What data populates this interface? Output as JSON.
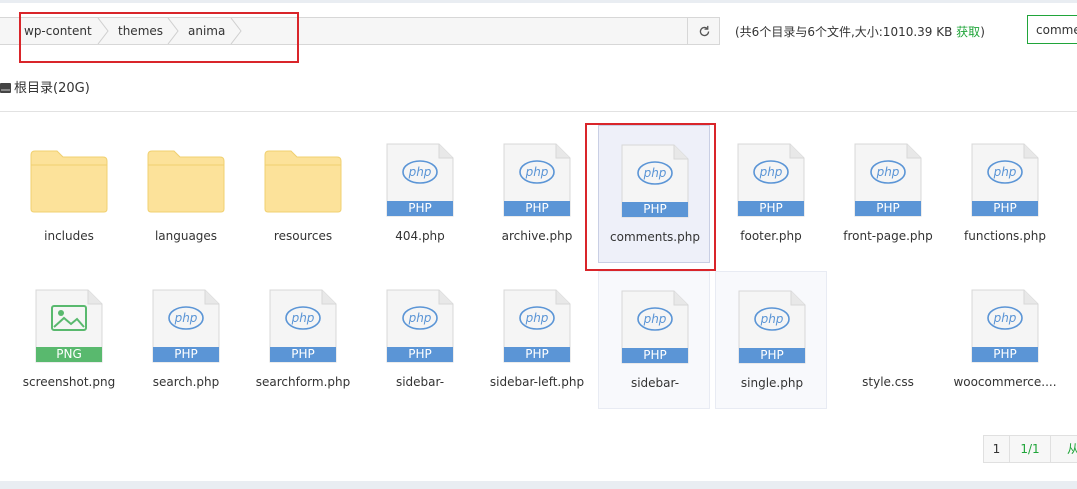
{
  "breadcrumb": [
    "wp-content",
    "themes",
    "anima"
  ],
  "summary": {
    "text": "(共6个目录与6个文件,大小:1010.39 KB ",
    "link": "获取",
    "close": ")"
  },
  "search": {
    "value": "comments"
  },
  "root": {
    "label": "根目录(20G)"
  },
  "colors": {
    "accent": "#20a53a",
    "folder": "#fce29a",
    "php": "#5b95d6",
    "png": "#59b96e",
    "mark": "#d9252a"
  },
  "files": [
    {
      "name": "includes",
      "type": "folder"
    },
    {
      "name": "languages",
      "type": "folder"
    },
    {
      "name": "resources",
      "type": "folder"
    },
    {
      "name": "404.php",
      "type": "php",
      "ext": "PHP"
    },
    {
      "name": "archive.php",
      "type": "php",
      "ext": "PHP"
    },
    {
      "name": "comments.php",
      "type": "php",
      "ext": "PHP",
      "state": "selected"
    },
    {
      "name": "footer.php",
      "type": "php",
      "ext": "PHP"
    },
    {
      "name": "front-page.php",
      "type": "php",
      "ext": "PHP"
    },
    {
      "name": "functions.php",
      "type": "php",
      "ext": "PHP"
    },
    {
      "name": "screenshot.png",
      "type": "png",
      "ext": "PNG"
    },
    {
      "name": "search.php",
      "type": "php",
      "ext": "PHP"
    },
    {
      "name": "searchform.php",
      "type": "php",
      "ext": "PHP"
    },
    {
      "name": "sidebar-",
      "type": "php",
      "ext": "PHP"
    },
    {
      "name": "sidebar-left.php",
      "type": "php",
      "ext": "PHP"
    },
    {
      "name": "sidebar-",
      "type": "php",
      "ext": "PHP",
      "state": "hover"
    },
    {
      "name": "single.php",
      "type": "php",
      "ext": "PHP",
      "state": "hover"
    },
    {
      "name": "style.css",
      "type": "blank"
    },
    {
      "name": "woocommerce....",
      "type": "php",
      "ext": "PHP"
    }
  ],
  "pager": {
    "current": "1",
    "total": "1/1",
    "next": "从"
  }
}
